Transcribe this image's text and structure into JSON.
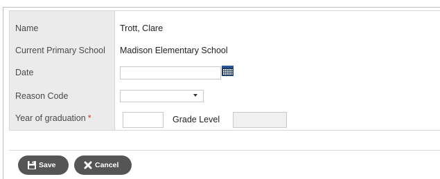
{
  "form": {
    "fields": [
      {
        "label": "Name",
        "value": "Trott, Clare"
      },
      {
        "label": "Current Primary School",
        "value": "Madison Elementary School"
      },
      {
        "label": "Date",
        "value": ""
      },
      {
        "label": "Reason Code",
        "value": ""
      },
      {
        "label": "Year of graduation",
        "value": "",
        "required_marker": "*"
      }
    ],
    "grade_level_label": "Grade Level",
    "grade_level_value": ""
  },
  "buttons": {
    "save_label": "Save",
    "cancel_label": "Cancel"
  },
  "icons": {
    "calendar": "calendar-icon",
    "dropdown": "chevron-down-icon",
    "save": "floppy-disk-icon",
    "cancel": "close-x-icon"
  },
  "colors": {
    "button_bg": "#555555",
    "label_bg": "#ebebeb",
    "required": "#d9302c",
    "calendar_icon": "#1f3b66"
  }
}
